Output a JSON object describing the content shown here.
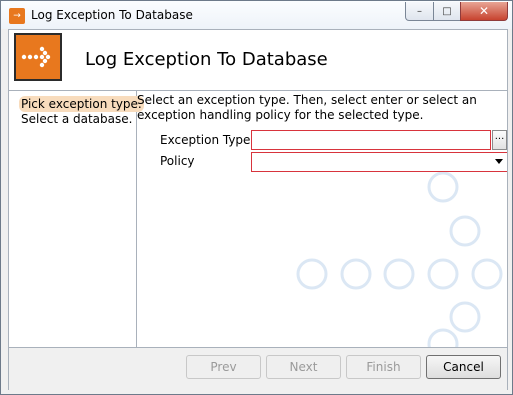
{
  "window": {
    "title": "Log Exception To Database",
    "controls": {
      "minimize": "–",
      "maximize": "□",
      "close": "✕"
    }
  },
  "header": {
    "title": "Log Exception To Database",
    "icon": "arrow-dots-icon"
  },
  "steps": [
    {
      "label": "Pick exception type.",
      "active": true
    },
    {
      "label": "Select a database.",
      "active": false
    }
  ],
  "content": {
    "instructions": "Select an exception type.  Then, select enter or select an exception handling policy for the selected type.",
    "exception_type": {
      "label": "Exception Type",
      "value": "",
      "browse_label": "..."
    },
    "policy": {
      "label": "Policy",
      "value": ""
    }
  },
  "footer": {
    "prev_label": "Prev",
    "next_label": "Next",
    "finish_label": "Finish",
    "cancel_label": "Cancel"
  },
  "colors": {
    "accent": "#e8781e",
    "error_border": "#d8343d",
    "active_step": "#f8dcbd",
    "decoration": "#dbe7f4"
  }
}
